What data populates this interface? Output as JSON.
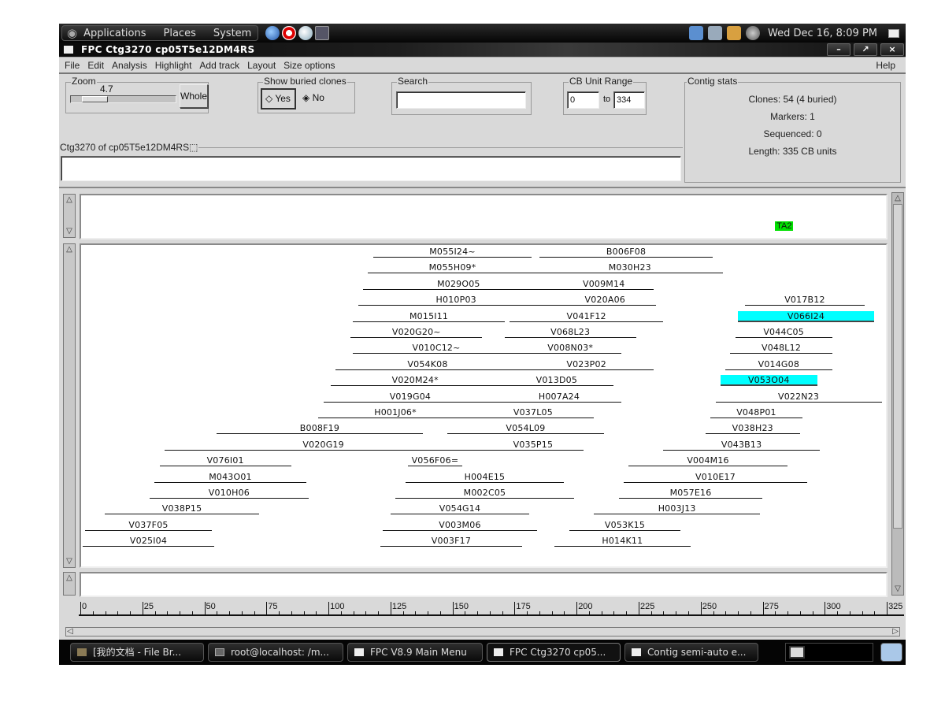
{
  "panel": {
    "menus": [
      "Applications",
      "Places",
      "System"
    ],
    "launchers": [
      "firefox-icon",
      "help-lifebuoy-icon",
      "evolution-mail-icon",
      "terminal-icon"
    ],
    "tray": [
      "network-manager-icon",
      "network-icon",
      "clipboard-icon",
      "volume-icon"
    ],
    "clock": "Wed Dec 16,  8:09 PM"
  },
  "window": {
    "title": "FPC Ctg3270 cp05T5e12DM4RS",
    "buttons": {
      "minimize": "–",
      "maximize": "↗",
      "close": "×"
    }
  },
  "menubar": {
    "items": [
      "File",
      "Edit",
      "Analysis",
      "Highlight",
      "Add track",
      "Layout",
      "Size options"
    ],
    "help": "Help"
  },
  "zoom": {
    "label": "Zoom",
    "value": "4.7",
    "slider_fraction": 0.1,
    "whole_button": "Whole"
  },
  "buried": {
    "label": "Show buried clones",
    "yes": "Yes",
    "no": "No",
    "selected": "Yes"
  },
  "search": {
    "label": "Search",
    "value": ""
  },
  "cb_range": {
    "label": "CB Unit Range",
    "from": "0",
    "to_label": "to",
    "to": "334"
  },
  "contig_frame": {
    "label": "Ctg3270 of cp05T5e12DM4RS⬚",
    "value": ""
  },
  "stats": {
    "label": "Contig stats",
    "clones": "Clones: 54 (4 buried)",
    "markers": "Markers: 1",
    "sequenced": "Sequenced: 0",
    "length": "Length: 335 CB units"
  },
  "colors": {
    "highlight": "#00ffff",
    "marker": "#00e000"
  },
  "marker_track": {
    "markers": [
      {
        "name": "TA2",
        "pos": 279
      }
    ]
  },
  "clone_track": {
    "rows": [
      [
        {
          "name": "M055I24~",
          "start": 117,
          "end": 181
        },
        {
          "name": "B006F08",
          "start": 184,
          "end": 254
        }
      ],
      [
        {
          "name": "M055H09*",
          "start": 115,
          "end": 183
        },
        {
          "name": "M030H23",
          "start": 183,
          "end": 258
        }
      ],
      [
        {
          "name": "M029O05",
          "start": 113,
          "end": 190
        },
        {
          "name": "V009M14",
          "start": 190,
          "end": 230
        }
      ],
      [
        {
          "name": "H010P03",
          "start": 111,
          "end": 190
        },
        {
          "name": "V020A06",
          "start": 190,
          "end": 231
        },
        {
          "name": "V017B12",
          "start": 267,
          "end": 315
        }
      ],
      [
        {
          "name": "M015I11",
          "start": 109,
          "end": 170
        },
        {
          "name": "V041F12",
          "start": 172,
          "end": 234
        },
        {
          "name": "V066I24",
          "start": 264,
          "end": 319,
          "highlight": true
        }
      ],
      [
        {
          "name": "V020G20~",
          "start": 108,
          "end": 161
        },
        {
          "name": "V068L23",
          "start": 170,
          "end": 223
        },
        {
          "name": "V044C05",
          "start": 263,
          "end": 302
        }
      ],
      [
        {
          "name": "V010C12~",
          "start": 109,
          "end": 176
        },
        {
          "name": "V008N03*",
          "start": 176,
          "end": 217
        },
        {
          "name": "V048L12",
          "start": 261,
          "end": 302
        }
      ],
      [
        {
          "name": "V054K08",
          "start": 102,
          "end": 176
        },
        {
          "name": "V023P02",
          "start": 176,
          "end": 230
        },
        {
          "name": "V014G08",
          "start": 259,
          "end": 302
        }
      ],
      [
        {
          "name": "V020M24*",
          "start": 100,
          "end": 168
        },
        {
          "name": "V013D05",
          "start": 168,
          "end": 214
        },
        {
          "name": "V053O04",
          "start": 257,
          "end": 296,
          "highlight": true
        }
      ],
      [
        {
          "name": "V019G04",
          "start": 97,
          "end": 167
        },
        {
          "name": "H007A24",
          "start": 167,
          "end": 217
        },
        {
          "name": "V022N23",
          "start": 255,
          "end": 322
        }
      ],
      [
        {
          "name": "H001J06*",
          "start": 95,
          "end": 157
        },
        {
          "name": "V037L05",
          "start": 157,
          "end": 206
        },
        {
          "name": "V048P01",
          "start": 253,
          "end": 290
        }
      ],
      [
        {
          "name": "B008F19",
          "start": 54,
          "end": 137
        },
        {
          "name": "V054L09",
          "start": 147,
          "end": 210
        },
        {
          "name": "V038H23",
          "start": 251,
          "end": 289
        }
      ],
      [
        {
          "name": "V020G19",
          "start": 33,
          "end": 161
        },
        {
          "name": "V035P15",
          "start": 161,
          "end": 202
        },
        {
          "name": "V043B13",
          "start": 234,
          "end": 297
        }
      ],
      [
        {
          "name": "V076I01",
          "start": 31,
          "end": 84
        },
        {
          "name": "V056F06=",
          "start": 131,
          "end": 153
        },
        {
          "name": "V004M16",
          "start": 220,
          "end": 284
        }
      ],
      [
        {
          "name": "M043O01",
          "start": 29,
          "end": 90
        },
        {
          "name": "H004E15",
          "start": 130,
          "end": 194
        },
        {
          "name": "V010E17",
          "start": 218,
          "end": 292
        }
      ],
      [
        {
          "name": "V010H06",
          "start": 27,
          "end": 91
        },
        {
          "name": "M002C05",
          "start": 126,
          "end": 198
        },
        {
          "name": "M057E16",
          "start": 216,
          "end": 274
        }
      ],
      [
        {
          "name": "V038P15",
          "start": 9,
          "end": 71
        },
        {
          "name": "V054G14",
          "start": 124,
          "end": 180
        },
        {
          "name": "H003J13",
          "start": 206,
          "end": 273
        }
      ],
      [
        {
          "name": "V037F05",
          "start": 1,
          "end": 52
        },
        {
          "name": "V003M06",
          "start": 121,
          "end": 183
        },
        {
          "name": "V053K15",
          "start": 196,
          "end": 241
        }
      ],
      [
        {
          "name": "V025I04",
          "start": 0,
          "end": 53
        },
        {
          "name": "V003F17",
          "start": 120,
          "end": 177
        },
        {
          "name": "H014K11",
          "start": 190,
          "end": 245
        }
      ]
    ]
  },
  "ruler": {
    "min": 0,
    "max": 325,
    "major_step": 25,
    "minor_step": 5,
    "labels": [
      "0",
      "25",
      "50",
      "75",
      "100",
      "125",
      "150",
      "175",
      "200",
      "225",
      "250",
      "275",
      "300",
      "325"
    ]
  },
  "taskbar": {
    "tasks": [
      {
        "label": "[我的文档 - File Br...",
        "icon": "folder"
      },
      {
        "label": "root@localhost: /m...",
        "icon": "term"
      },
      {
        "label": "FPC V8.9 Main Menu",
        "icon": "win"
      },
      {
        "label": "FPC Ctg3270 cp05...",
        "icon": "win",
        "active": true
      },
      {
        "label": "Contig semi-auto e...",
        "icon": "win"
      }
    ]
  }
}
